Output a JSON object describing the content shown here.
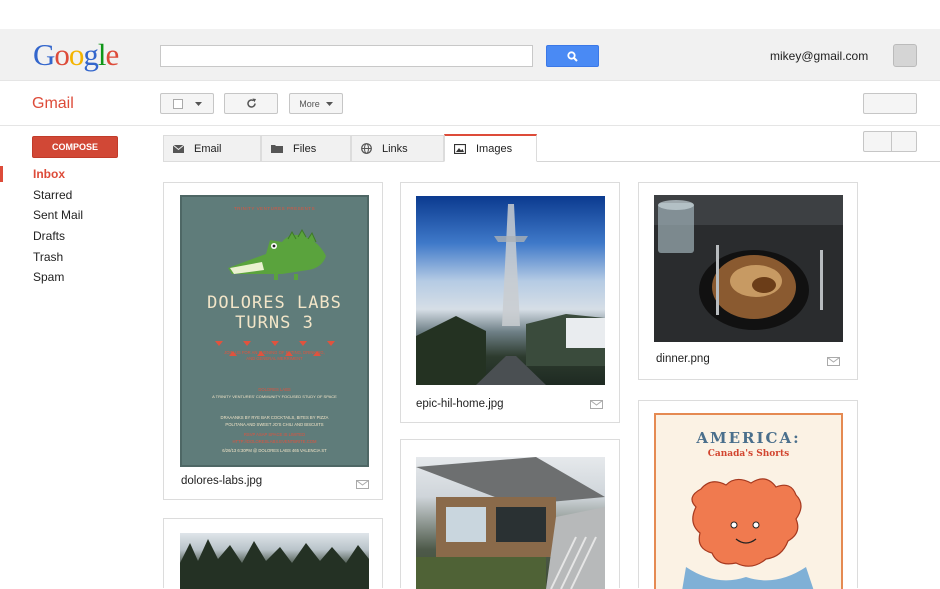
{
  "header": {
    "logo_letters": [
      {
        "ch": "G",
        "color": "#3366cc"
      },
      {
        "ch": "o",
        "color": "#dd4b39"
      },
      {
        "ch": "o",
        "color": "#f4b400"
      },
      {
        "ch": "g",
        "color": "#3366cc"
      },
      {
        "ch": "l",
        "color": "#109618"
      },
      {
        "ch": "e",
        "color": "#dd4b39"
      }
    ],
    "search_value": "",
    "search_icon": "search-icon",
    "user_email": "mikey@gmail.com"
  },
  "toolbar": {
    "app_label": "Gmail",
    "more_label": "More",
    "refresh_icon": "refresh-icon"
  },
  "sidebar": {
    "compose_label": "COMPOSE",
    "items": [
      {
        "label": "Inbox",
        "active": true
      },
      {
        "label": "Starred",
        "active": false
      },
      {
        "label": "Sent Mail",
        "active": false
      },
      {
        "label": "Drafts",
        "active": false
      },
      {
        "label": "Trash",
        "active": false
      },
      {
        "label": "Spam",
        "active": false
      }
    ]
  },
  "tabs": [
    {
      "label": "Email",
      "icon": "envelope-icon",
      "active": false
    },
    {
      "label": "Files",
      "icon": "folder-icon",
      "active": false
    },
    {
      "label": "Links",
      "icon": "globe-icon",
      "active": false
    },
    {
      "label": "Images",
      "icon": "image-icon",
      "active": true
    }
  ],
  "images": [
    {
      "filename": "dolores-labs.jpg"
    },
    {
      "filename": "epic-hil-home.jpg"
    },
    {
      "filename": "dinner.png"
    },
    {
      "filename": ""
    },
    {
      "filename": ""
    },
    {
      "filename": ""
    }
  ],
  "poster1": {
    "presents": "TRINITY VENTURES PRESENTS",
    "title_line1": "DOLORES LABS",
    "title_line2": "TURNS 3",
    "invite1": "JOIN US FOR AN EVENING OF EATING, DRINKING,",
    "invite2": "AND GENERAL MERRIMENT",
    "org": "DOLORES LABS",
    "tagline": "A TRINITY VENTURES' COMMUNITY FOCUSED STUDY OF SPACE",
    "drinks1": "DRAAANKS BY RYE BAR COCKTAILS, BITES BY PIZZA",
    "drinks2": "POLITANA AND SWEET JO'S CHILI AND BISCUITS",
    "rsvp1": "RSVP ASAP SPACE IS LIMITED",
    "rsvp2": "HTTP://DOLORESLABS.EVENTBRITE.COM",
    "date": "6/26/13 6:30PM @ DOLORES LABS 465 VALENCIA ST"
  },
  "poster2": {
    "title": "AMERICA:",
    "subtitle": "Canada's Shorts"
  },
  "colors": {
    "accent_red": "#dd4b39",
    "search_blue": "#4a8af4",
    "poster_teal": "#5f7c7a"
  }
}
